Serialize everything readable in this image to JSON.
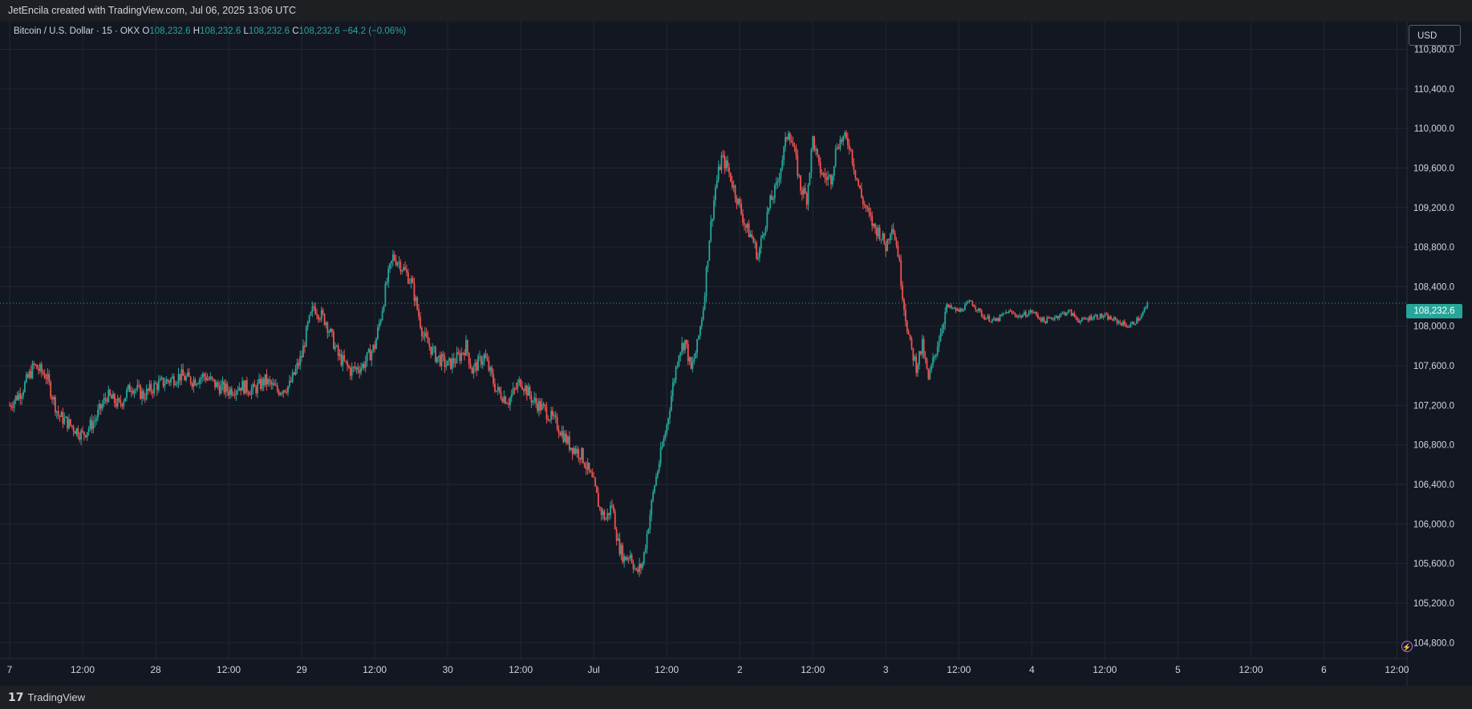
{
  "header": {
    "caption": "JetEncila created with TradingView.com, Jul 06, 2025 13:06 UTC"
  },
  "footer": {
    "brand_mark": "17",
    "brand": "TradingView"
  },
  "legend": {
    "symbol": "Bitcoin / U.S. Dollar · 15 · OKX",
    "o_label": "O",
    "o_value": "108,232.6",
    "h_label": "H",
    "h_value": "108,232.6",
    "l_label": "L",
    "l_value": "108,232.6",
    "c_label": "C",
    "c_value": "108,232.6",
    "change": "−64.2 (−0.06%)"
  },
  "controls": {
    "currency": "USD",
    "lightning_icon": "⚡"
  },
  "colors": {
    "background": "#131722",
    "grid": "#232732",
    "up": "#26a69a",
    "down": "#ef5350",
    "text": "#d1d4dc",
    "last_price_line": "#26a69a"
  },
  "chart_data": {
    "type": "candlestick",
    "title": "Bitcoin / U.S. Dollar · 15 · OKX",
    "xlabel": "",
    "ylabel": "",
    "currency": "USD",
    "interval_minutes": 15,
    "x_range": [
      "Jun 27 00:00",
      "Jul 6 13:00"
    ],
    "ylim": [
      104640,
      111080
    ],
    "y_ticks": [
      104800,
      105200,
      105600,
      106000,
      106400,
      106800,
      107200,
      107600,
      108000,
      108400,
      108800,
      109200,
      109600,
      110000,
      110400,
      110800
    ],
    "y_tick_labels": [
      "104,800.0",
      "105,200.0",
      "105,600.0",
      "106,000.0",
      "106,400.0",
      "106,800.0",
      "107,200.0",
      "107,600.0",
      "108,000.0",
      "108,400.0",
      "108,800.0",
      "109,200.0",
      "109,600.0",
      "110,000.0",
      "110,400.0",
      "110,800.0"
    ],
    "x_tick_labels": [
      "7",
      "12:00",
      "28",
      "12:00",
      "29",
      "12:00",
      "30",
      "12:00",
      "Jul",
      "12:00",
      "2",
      "12:00",
      "3",
      "12:00",
      "4",
      "12:00",
      "5",
      "12:00",
      "6",
      "12:00"
    ],
    "x_tick_hours": [
      0,
      12,
      24,
      36,
      48,
      60,
      72,
      84,
      96,
      108,
      120,
      132,
      144,
      156,
      168,
      180,
      192,
      204,
      216,
      228
    ],
    "last_price": 108232.6,
    "last_price_label": "108,232.6",
    "price_path": [
      [
        0,
        107200
      ],
      [
        2,
        107350
      ],
      [
        4,
        107600
      ],
      [
        6,
        107500
      ],
      [
        8,
        107100
      ],
      [
        10,
        107000
      ],
      [
        12,
        106900
      ],
      [
        14,
        107050
      ],
      [
        16,
        107300
      ],
      [
        18,
        107200
      ],
      [
        20,
        107400
      ],
      [
        22,
        107300
      ],
      [
        24,
        107400
      ],
      [
        26,
        107450
      ],
      [
        28,
        107500
      ],
      [
        30,
        107450
      ],
      [
        32,
        107500
      ],
      [
        34,
        107400
      ],
      [
        36,
        107350
      ],
      [
        38,
        107400
      ],
      [
        40,
        107350
      ],
      [
        42,
        107450
      ],
      [
        44,
        107350
      ],
      [
        46,
        107400
      ],
      [
        48,
        107700
      ],
      [
        49,
        108000
      ],
      [
        50,
        108200
      ],
      [
        52,
        108050
      ],
      [
        54,
        107700
      ],
      [
        56,
        107550
      ],
      [
        58,
        107600
      ],
      [
        60,
        107800
      ],
      [
        61,
        108100
      ],
      [
        62,
        108450
      ],
      [
        63,
        108700
      ],
      [
        64,
        108650
      ],
      [
        66,
        108450
      ],
      [
        68,
        107900
      ],
      [
        70,
        107700
      ],
      [
        72,
        107600
      ],
      [
        74,
        107700
      ],
      [
        75,
        107800
      ],
      [
        76,
        107550
      ],
      [
        78,
        107700
      ],
      [
        80,
        107350
      ],
      [
        82,
        107250
      ],
      [
        84,
        107450
      ],
      [
        86,
        107250
      ],
      [
        88,
        107150
      ],
      [
        90,
        107000
      ],
      [
        92,
        106800
      ],
      [
        94,
        106700
      ],
      [
        96,
        106400
      ],
      [
        97,
        106150
      ],
      [
        98,
        106050
      ],
      [
        99,
        106200
      ],
      [
        100,
        105800
      ],
      [
        101,
        105650
      ],
      [
        102,
        105700
      ],
      [
        103,
        105500
      ],
      [
        104,
        105600
      ],
      [
        105,
        106000
      ],
      [
        106,
        106400
      ],
      [
        107,
        106700
      ],
      [
        108,
        107000
      ],
      [
        109,
        107400
      ],
      [
        110,
        107750
      ],
      [
        111,
        107850
      ],
      [
        112,
        107550
      ],
      [
        113,
        107800
      ],
      [
        114,
        108200
      ],
      [
        115,
        108900
      ],
      [
        116,
        109400
      ],
      [
        117,
        109700
      ],
      [
        118,
        109600
      ],
      [
        119,
        109400
      ],
      [
        120,
        109200
      ],
      [
        121,
        109000
      ],
      [
        122,
        108900
      ],
      [
        123,
        108700
      ],
      [
        124,
        109000
      ],
      [
        125,
        109250
      ],
      [
        126,
        109400
      ],
      [
        127,
        109700
      ],
      [
        128,
        110000
      ],
      [
        129,
        109750
      ],
      [
        130,
        109400
      ],
      [
        131,
        109300
      ],
      [
        132,
        109900
      ],
      [
        133,
        109600
      ],
      [
        134,
        109500
      ],
      [
        135,
        109500
      ],
      [
        136,
        109850
      ],
      [
        137,
        109900
      ],
      [
        138,
        109850
      ],
      [
        139,
        109550
      ],
      [
        140,
        109300
      ],
      [
        141,
        109150
      ],
      [
        142,
        109000
      ],
      [
        143,
        108950
      ],
      [
        144,
        108800
      ],
      [
        145,
        109050
      ],
      [
        146,
        108750
      ],
      [
        147,
        108200
      ],
      [
        148,
        107800
      ],
      [
        149,
        107600
      ],
      [
        150,
        107800
      ],
      [
        151,
        107450
      ],
      [
        152,
        107700
      ],
      [
        153,
        107950
      ],
      [
        154,
        108200
      ],
      [
        156,
        108150
      ],
      [
        158,
        108250
      ],
      [
        160,
        108100
      ],
      [
        162,
        108050
      ],
      [
        164,
        108150
      ],
      [
        166,
        108100
      ],
      [
        168,
        108150
      ],
      [
        170,
        108050
      ],
      [
        172,
        108100
      ],
      [
        174,
        108150
      ],
      [
        176,
        108050
      ],
      [
        178,
        108100
      ],
      [
        180,
        108100
      ],
      [
        182,
        108050
      ],
      [
        184,
        108000
      ],
      [
        186,
        108100
      ],
      [
        187,
        108232.6
      ]
    ]
  }
}
